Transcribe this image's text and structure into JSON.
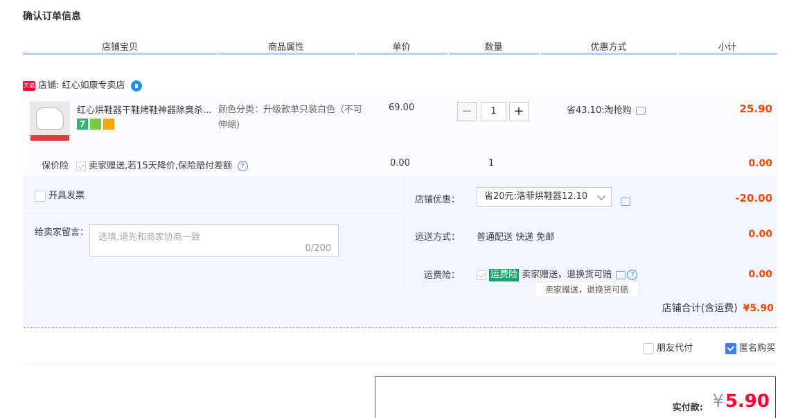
{
  "title": "确认订单信息",
  "headers": [
    "店铺宝贝",
    "商品属性",
    "单价",
    "数量",
    "优惠方式",
    "小计"
  ],
  "shop": {
    "tag": "天猫",
    "label": "店铺:",
    "name": "红心如康专卖店"
  },
  "item": {
    "name": "红心烘鞋器干鞋烤鞋神器除臭杀...",
    "badge_seven": "7",
    "attribute": "颜色分类：升级款单只装白色（不可伸缩)",
    "unit_price": "69.00",
    "quantity": "1",
    "qty_minus": "−",
    "qty_plus": "+",
    "promo": "省43.10:淘抢购",
    "subtotal": "25.90"
  },
  "insurance": {
    "label": "保价险",
    "text": "卖家赠送,若15天降价,保险赔付差额",
    "help": "?",
    "price": "0.00",
    "qty": "1",
    "subtotal": "0.00"
  },
  "invoice": {
    "label": "开具发票"
  },
  "message": {
    "label": "给卖家留言：",
    "placeholder": "选填,请先和商家协商一致",
    "counter": "0/200"
  },
  "shop_discount": {
    "label": "店铺优惠：",
    "selected": "省20元:洛菲烘鞋器12.10",
    "amount": "-20.00"
  },
  "shipping": {
    "label": "运送方式：",
    "method": "普通配送 快递 免邮",
    "amount": "0.00"
  },
  "shipping_insurance": {
    "label": "运费险：",
    "tag": "运费险",
    "text": "卖家赠送，退换货可赔",
    "help": "?",
    "amount": "0.00",
    "tooltip": "卖家赠送，退换货可赔"
  },
  "shop_total": {
    "label": "店铺合计(含运费)",
    "amount": "¥5.90"
  },
  "options": {
    "friend_pay": "朋友代付",
    "anonymous": "匿名购买"
  },
  "payment": {
    "label": "实付款:",
    "currency": "¥",
    "amount": "5.90"
  },
  "colors": {
    "accent_red": "#ff0036",
    "price_orange": "#ff4400",
    "header_line": "#b2d1ff",
    "panel_bg": "#f2f7ff"
  }
}
